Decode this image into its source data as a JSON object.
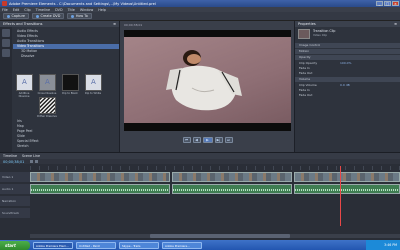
{
  "window": {
    "title": "Adobe Premiere Elements - C:\\Documents and Settings\\...\\My Videos\\Untitled.prel",
    "min": "_",
    "max": "□",
    "close": "×"
  },
  "menu": [
    "File",
    "Edit",
    "Clip",
    "Timeline",
    "DVD",
    "Title",
    "Window",
    "Help"
  ],
  "toolbar": {
    "capture": "Capture",
    "create_dvd": "Create DVD",
    "how_to": "How To"
  },
  "left_panel": {
    "title": "Effects and Transitions",
    "tree": [
      "Audio Effects",
      "Video Effects",
      "Audio Transitions",
      "Video Transitions",
      "3D Motion",
      "Dissolve"
    ],
    "tiles": [
      "Additive Dissolve",
      "Cross Dissolve",
      "Dip to Black",
      "Dip to White",
      "Dither Dissolve"
    ],
    "list": [
      "Iris",
      "Map",
      "Page Peel",
      "Slide",
      "Special Effect",
      "Stretch",
      "Wipe",
      "Zoom"
    ]
  },
  "monitor": {
    "timecode": "00;00;38;01",
    "controls": [
      "⏮",
      "◀",
      "▶",
      "▶|",
      "⏭"
    ]
  },
  "properties": {
    "title": "Properties",
    "clip_name": "Transition Clip",
    "clip_type": "Video Clip",
    "rows": [
      {
        "label": "Image Control",
        "value": ""
      },
      {
        "label": "Motion",
        "value": ""
      },
      {
        "label": "Opacity",
        "value": ""
      },
      {
        "label": "Clip Opacity",
        "value": "100.0%"
      },
      {
        "label": "Fade In",
        "value": ""
      },
      {
        "label": "Fade Out",
        "value": ""
      },
      {
        "label": "Volume",
        "value": ""
      },
      {
        "label": "Clip Volume",
        "value": "0.0 dB"
      },
      {
        "label": "Fade In",
        "value": ""
      },
      {
        "label": "Fade Out",
        "value": ""
      }
    ]
  },
  "timeline": {
    "tabs": [
      "Timeline",
      "Scene Line"
    ],
    "timecode": "00;00;38;01",
    "tracks": [
      "Video 1",
      "Audio 1",
      "Narration",
      "Soundtrack"
    ]
  },
  "taskbar": {
    "start": "start",
    "tasks": [
      "Adobe Premiere Elem...",
      "Untitled - Paint",
      "Skype - Trails",
      "Adobe Premiere..."
    ],
    "clock": "3:46 PM"
  }
}
